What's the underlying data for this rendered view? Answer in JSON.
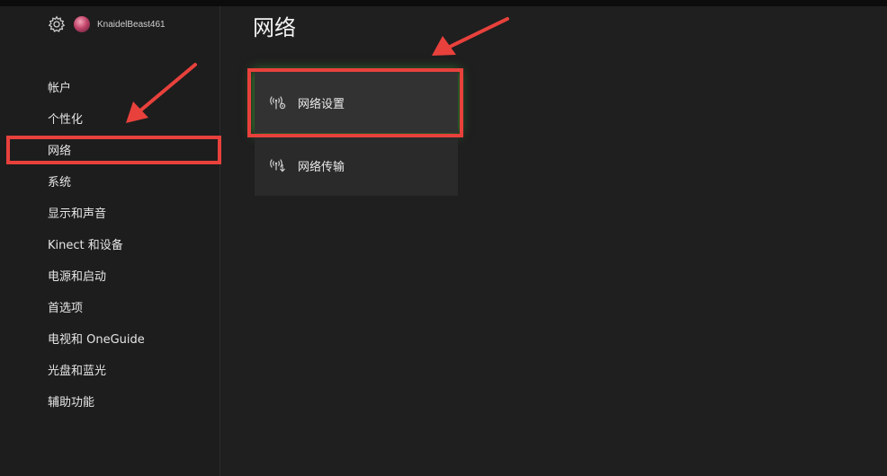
{
  "user": {
    "gamertag": "KnaidelBeast461"
  },
  "icons": {
    "settings": "gear-icon",
    "network_settings": "wifi-gear-icon",
    "network_transfer": "wifi-download-icon"
  },
  "colors": {
    "highlight": "#e8413c",
    "focus_glow": "#46d23c",
    "background": "#1f1f1f"
  },
  "sidebar": {
    "items": [
      {
        "label": "帐户"
      },
      {
        "label": "个性化"
      },
      {
        "label": "网络"
      },
      {
        "label": "系统"
      },
      {
        "label": "显示和声音"
      },
      {
        "label": "Kinect 和设备"
      },
      {
        "label": "电源和启动"
      },
      {
        "label": "首选项"
      },
      {
        "label": "电视和 OneGuide"
      },
      {
        "label": "光盘和蓝光"
      },
      {
        "label": "辅助功能"
      }
    ]
  },
  "main": {
    "title": "网络",
    "cards": [
      {
        "label": "网络设置"
      },
      {
        "label": "网络传输"
      }
    ]
  }
}
